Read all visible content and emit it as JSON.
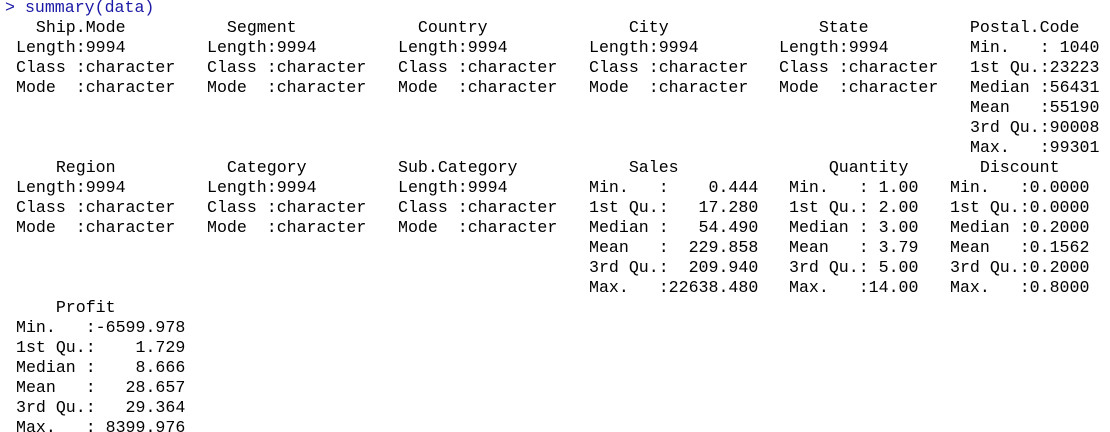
{
  "console": {
    "prompt": ">",
    "command": "summary(data)",
    "colors": {
      "command": "#1a1aa6",
      "output": "#000000",
      "background": "#ffffff"
    },
    "blocks": [
      {
        "columns": [
          {
            "name": "  Ship.Mode",
            "rows": [
              "Length:9994",
              "Class :character",
              "Mode  :character"
            ]
          },
          {
            "name": "  Segment",
            "rows": [
              "Length:9994",
              "Class :character",
              "Mode  :character"
            ]
          },
          {
            "name": "  Country",
            "rows": [
              "Length:9994",
              "Class :character",
              "Mode  :character"
            ]
          },
          {
            "name": "    City",
            "rows": [
              "Length:9994",
              "Class :character",
              "Mode  :character"
            ]
          },
          {
            "name": "    State",
            "rows": [
              "Length:9994",
              "Class :character",
              "Mode  :character"
            ]
          },
          {
            "name": "  Postal.Code",
            "rows": [
              "Min.   : 1040",
              "1st Qu.:23223",
              "Median :56431",
              "Mean   :55190",
              "3rd Qu.:90008",
              "Max.   :99301"
            ]
          }
        ]
      },
      {
        "columns": [
          {
            "name": "    Region",
            "rows": [
              "Length:9994",
              "Class :character",
              "Mode  :character"
            ]
          },
          {
            "name": "  Category",
            "rows": [
              "Length:9994",
              "Class :character",
              "Mode  :character"
            ]
          },
          {
            "name": "Sub.Category",
            "rows": [
              "Length:9994",
              "Class :character",
              "Mode  :character"
            ]
          },
          {
            "name": "    Sales",
            "rows": [
              "Min.   :    0.444",
              "1st Qu.:   17.280",
              "Median :   54.490",
              "Mean   :  229.858",
              "3rd Qu.:  209.940",
              "Max.   :22638.480"
            ]
          },
          {
            "name": "    Quantity",
            "rows": [
              "Min.   : 1.00",
              "1st Qu.: 2.00",
              "Median : 3.00",
              "Mean   : 3.79",
              "3rd Qu.: 5.00",
              "Max.   :14.00"
            ]
          },
          {
            "name": "   Discount",
            "rows": [
              "Min.   :0.0000",
              "1st Qu.:0.0000",
              "Median :0.2000",
              "Mean   :0.1562",
              "3rd Qu.:0.2000",
              "Max.   :0.8000"
            ]
          }
        ]
      },
      {
        "columns": [
          {
            "name": "    Profit",
            "rows": [
              "Min.   :-6599.978",
              "1st Qu.:    1.729",
              "Median :    8.666",
              "Mean   :   28.657",
              "3rd Qu.:   29.364",
              "Max.   : 8399.976"
            ]
          }
        ]
      }
    ]
  }
}
